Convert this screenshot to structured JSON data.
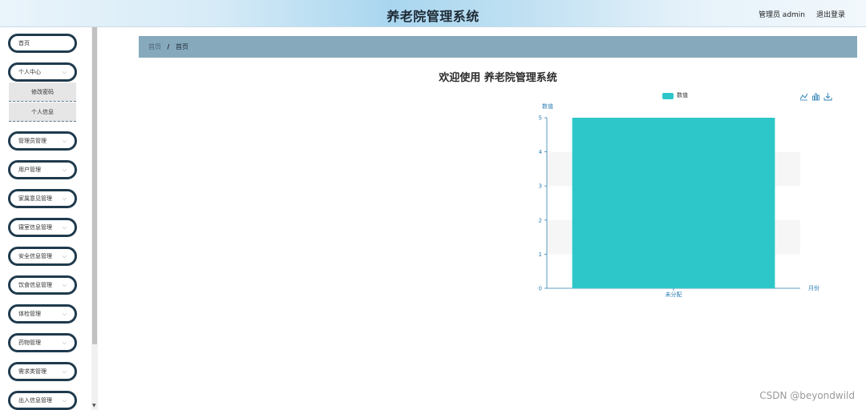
{
  "header": {
    "title": "养老院管理系统",
    "user": "管理员 admin",
    "logout": "退出登录"
  },
  "sidebar": {
    "items": [
      {
        "label": "首页",
        "chevron": false
      },
      {
        "label": "个人中心",
        "chevron": true,
        "expanded": true,
        "children": [
          "修改密码",
          "个人信息"
        ]
      },
      {
        "label": "管理员管理",
        "chevron": true
      },
      {
        "label": "用户管理",
        "chevron": true
      },
      {
        "label": "家属意见管理",
        "chevron": true
      },
      {
        "label": "寝室信息管理",
        "chevron": true
      },
      {
        "label": "安全信息管理",
        "chevron": true
      },
      {
        "label": "饮食信息管理",
        "chevron": true
      },
      {
        "label": "体检管理",
        "chevron": true
      },
      {
        "label": "药物管理",
        "chevron": true
      },
      {
        "label": "需求类管理",
        "chevron": true
      },
      {
        "label": "出入信息管理",
        "chevron": true
      }
    ],
    "chevron_icon": "chevron-down-icon"
  },
  "breadcrumb": {
    "home": "首页",
    "separator": "/",
    "current": "首页"
  },
  "main": {
    "welcome": "欢迎使用 养老院管理系统"
  },
  "chart_data": {
    "type": "bar",
    "categories": [
      "未分配"
    ],
    "series": [
      {
        "name": "数值",
        "values": [
          5
        ]
      }
    ],
    "xlabel": "月份",
    "ylabel": "数值",
    "ylim": [
      0,
      5
    ],
    "yticks": [
      "0",
      "1",
      "2",
      "3",
      "4",
      "5"
    ],
    "legend": "top-center",
    "color": "#2ec7c9",
    "toolbox": [
      "line-chart-icon",
      "bar-chart-icon",
      "download-icon"
    ]
  },
  "watermark": "CSDN @beyondwild"
}
